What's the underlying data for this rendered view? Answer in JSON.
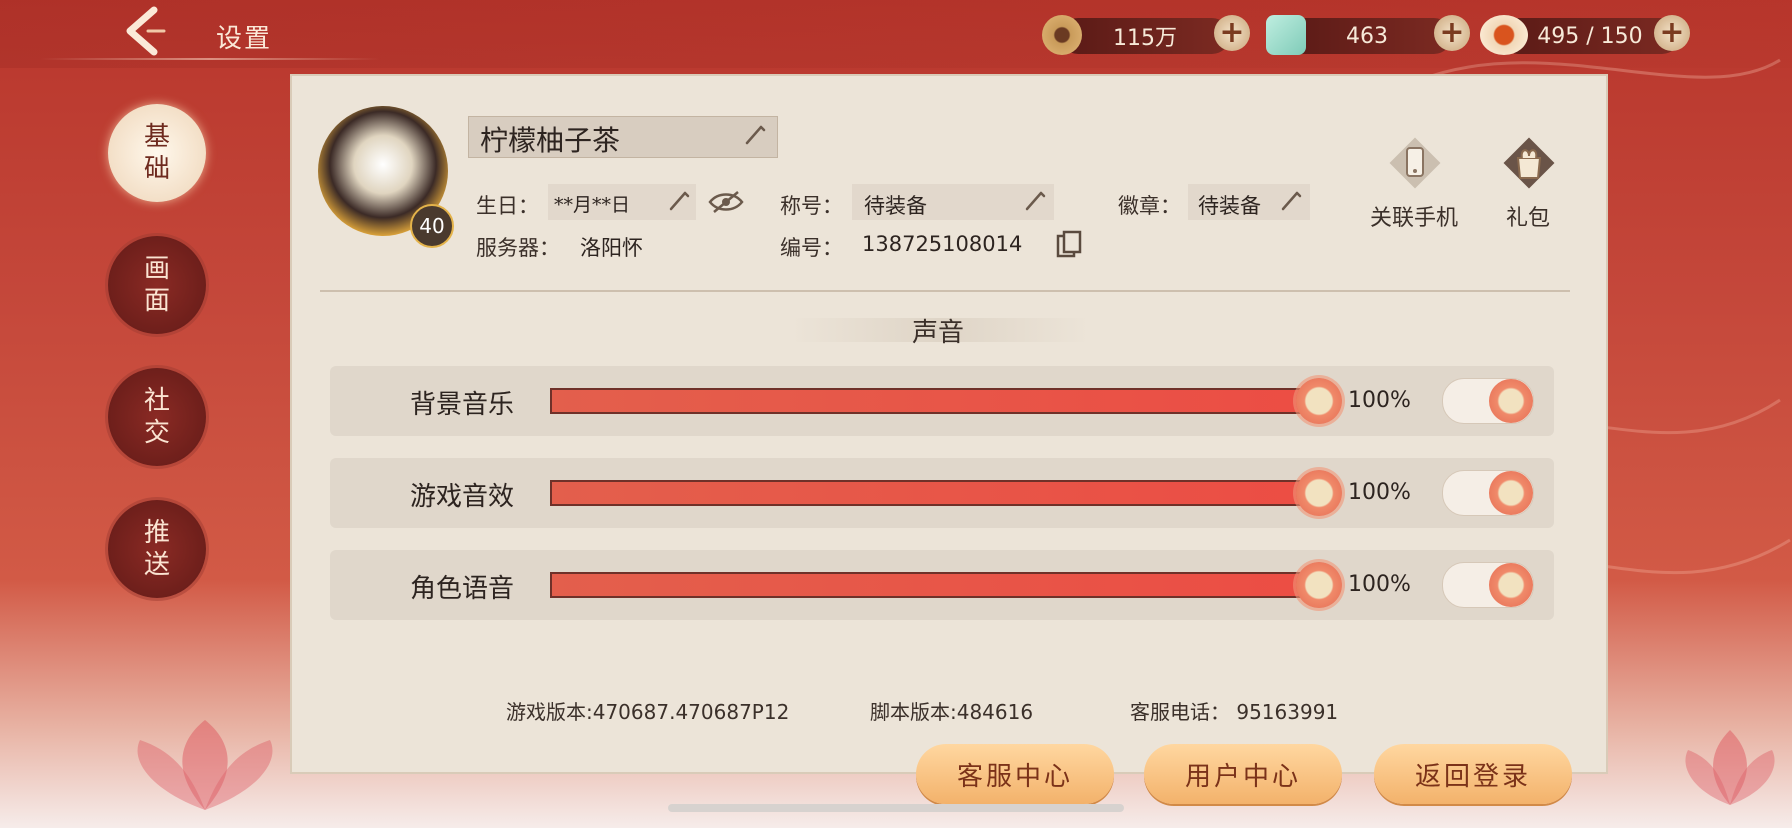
{
  "header": {
    "title": "设置"
  },
  "resources": [
    {
      "icon": "coin-icon",
      "value": "115万"
    },
    {
      "icon": "jade-icon",
      "value": "463"
    },
    {
      "icon": "stamina-icon",
      "value": "495 / 150"
    }
  ],
  "nav": [
    {
      "label": [
        "基",
        "础"
      ],
      "active": true
    },
    {
      "label": [
        "画",
        "面"
      ],
      "active": false
    },
    {
      "label": [
        "社",
        "交"
      ],
      "active": false
    },
    {
      "label": [
        "推",
        "送"
      ],
      "active": false
    }
  ],
  "profile": {
    "name": "柠檬柚子茶",
    "level": "40",
    "birthday_label": "生日：",
    "birthday_value": "**月**日",
    "title_label": "称号：",
    "title_value": "待装备",
    "badge_label": "徽章：",
    "badge_value": "待装备",
    "server_label": "服务器：",
    "server_value": "洛阳怀",
    "id_label": "编号：",
    "id_value": "138725108014"
  },
  "actions": {
    "link_phone": "关联手机",
    "gift": "礼包"
  },
  "sound": {
    "section_title": "声音",
    "rows": [
      {
        "label": "背景音乐",
        "value": 1.0,
        "percent": "100%",
        "enabled": true
      },
      {
        "label": "游戏音效",
        "value": 1.0,
        "percent": "100%",
        "enabled": true
      },
      {
        "label": "角色语音",
        "value": 1.0,
        "percent": "100%",
        "enabled": true
      }
    ]
  },
  "footer": {
    "game_version": "游戏版本:470687.470687P12",
    "script_version": "脚本版本:484616",
    "service_phone": "客服电话：  95163991",
    "buttons": [
      "客服中心",
      "用户中心",
      "返回登录"
    ]
  },
  "colors": {
    "accent": "#e35f4c",
    "panel": "#ece4d8",
    "nav_active": "#f3dfc7",
    "nav_inactive": "#6e1f1b"
  }
}
